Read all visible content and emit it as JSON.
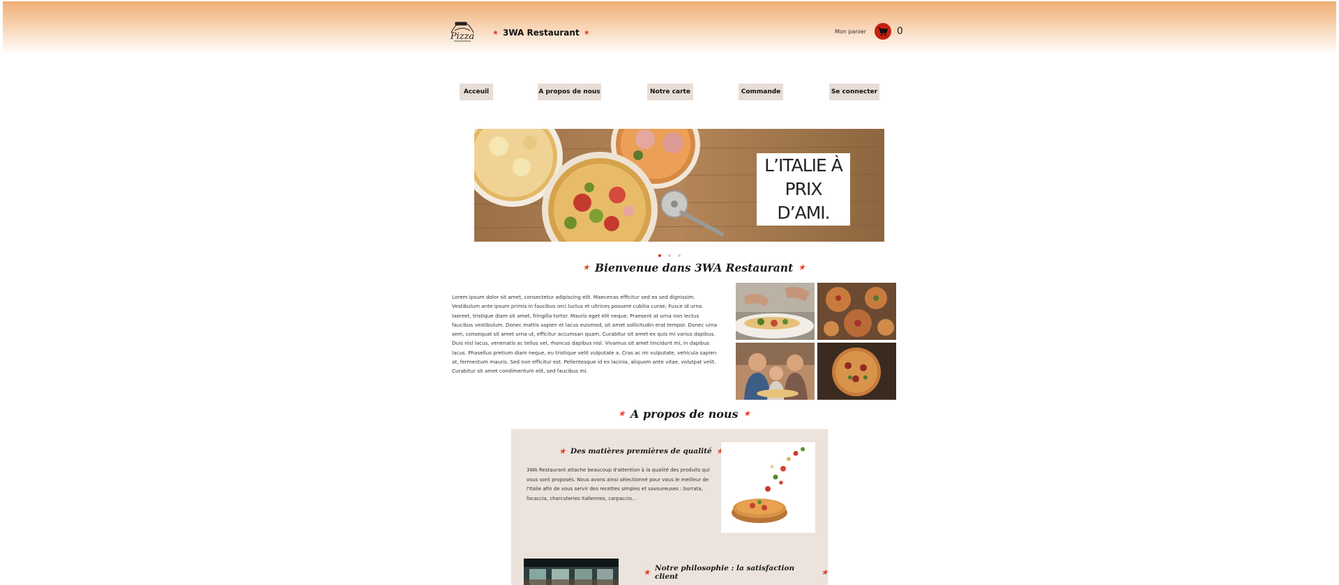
{
  "header": {
    "logo_text": "Pizza",
    "restaurant_name": "3WA Restaurant",
    "cart_label": "Mon panier",
    "cart_count": "0"
  },
  "nav": [
    {
      "label": "Acceuil"
    },
    {
      "label": "A propos de nous"
    },
    {
      "label": "Notre carte"
    },
    {
      "label": "Commande"
    },
    {
      "label": "Se connecter"
    }
  ],
  "banner": {
    "headline_line1": "L’ITALIE À PRIX",
    "headline_line2": "D’AMI."
  },
  "carousel": {
    "slides": 3,
    "active": 0
  },
  "welcome": {
    "title": "Bienvenue dans 3WA Restaurant",
    "text": "Lorem ipsum dolor sit amet, consectetur adipiscing elit. Maecenas efficitur sed ex sed dignissim. Vestibulum ante ipsum primis in faucibus orci luctus et ultrices posuere cubilia curae; Fusce id urna laoreet, tristique diam sit amet, fringilla tortor. Mauris eget elit neque. Praesent at urna non lectus faucibus vestibulum. Donec mattis sapien et lacus euismod, sit amet sollicitudin erat tempor. Donec urna sem, consequat sit amet urna ut, efficitur accumsan quam. Curabitur sit amet ex quis mi varius dapibus. Duis nisl lacus, venenatis ac tellus vel, rhoncus dapibus nisl. Vivamus sit amet tincidunt mi, in dapibus lacus. Phasellus pretium diam neque, eu tristique velit vulputate a. Cras ac mi vulputate, vehicula sapien at, fermentum mauris. Sed non efficitur est. Pellentesque id ex lacinia, aliquam ante vitae, volutpat velit. Curabitur sit amet condimentum elit, sed faucibus mi."
  },
  "about": {
    "title": "A propos de nous",
    "quality_title": "Des matières premières de qualité",
    "quality_text": "3WA Restaurant attache beaucoup d'attention à la qualité des produits qui vous sont proposés. Nous avons ainsi sélectionné pour vous le meilleur de l'Italie afin de vous servir des recettes simples et savoureuses : burrata, focaccia, charcuteries italiennes, carpaccio...",
    "philosophy_title": "Notre philosophie : la satisfaction client"
  },
  "colors": {
    "accent": "#e8422a",
    "cart": "#c8200f",
    "nav_bg": "#e7ddd6",
    "card_bg": "#ebe3dc",
    "header_top": "#efae74"
  },
  "icons": {
    "cart": "cart-icon",
    "star": "star-icon"
  }
}
